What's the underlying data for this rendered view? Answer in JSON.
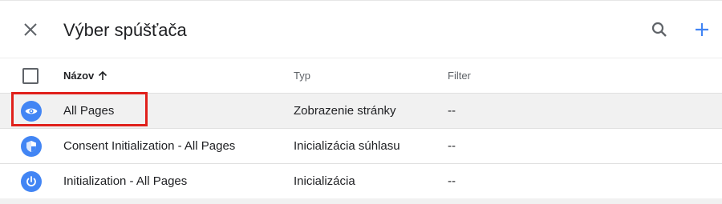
{
  "dialog": {
    "title": "Výber spúšťača"
  },
  "table": {
    "headers": {
      "name": "Názov",
      "type": "Typ",
      "filter": "Filter"
    },
    "rows": [
      {
        "name": "All Pages",
        "type": "Zobrazenie stránky",
        "filter": "--",
        "icon": "eye-icon",
        "selected": true
      },
      {
        "name": "Consent Initialization - All Pages",
        "type": "Inicializácia súhlasu",
        "filter": "--",
        "icon": "shield-icon",
        "selected": false
      },
      {
        "name": "Initialization - All Pages",
        "type": "Inicializácia",
        "filter": "--",
        "icon": "power-icon",
        "selected": false
      }
    ]
  },
  "colors": {
    "accent": "#4285f4",
    "highlight": "#e0201b",
    "selected_row": "#f1f1f1"
  },
  "icons": {
    "close": "close-icon",
    "search": "search-icon",
    "add": "plus-icon",
    "sort": "arrow-up-icon"
  }
}
